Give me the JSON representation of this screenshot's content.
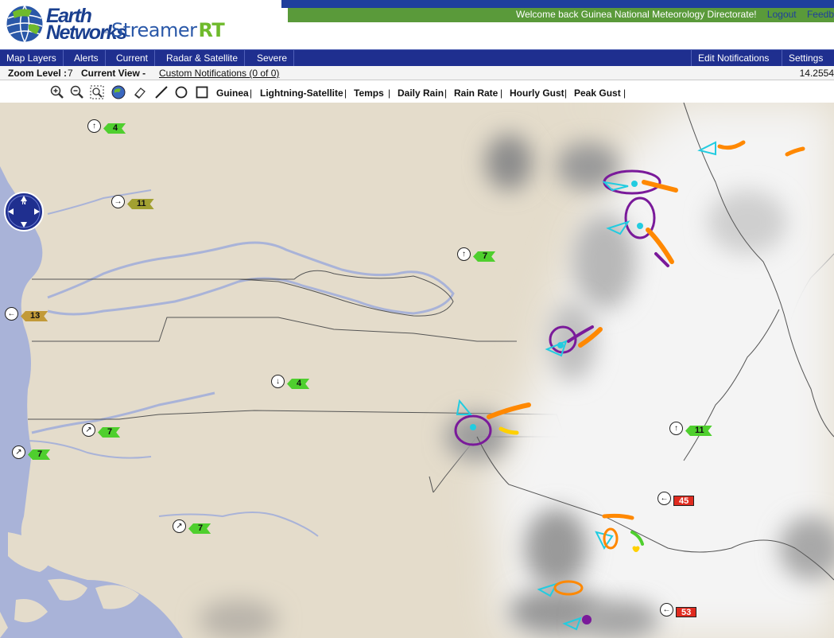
{
  "header": {
    "logo_line1": "Earth",
    "logo_line2": "Networks",
    "logo_tm": "SM",
    "product_name": "Streamer",
    "product_suffix": "RT",
    "welcome_text": "Welcome back Guinea National Meteorology Directorate!",
    "logout_label": "Logout",
    "feedback_label": "Feedb"
  },
  "menu": {
    "left": [
      "Map Layers",
      "Alerts",
      "Current",
      "Radar & Satellite",
      "Severe"
    ],
    "right": [
      "Edit Notifications",
      "Settings"
    ]
  },
  "infobar": {
    "zoom_label": "Zoom Level :",
    "zoom_value": "7",
    "view_label": "Current View -",
    "notifications_link": "Custom Notifications (0 of 0)",
    "coordinate": "14.2554"
  },
  "toolbar": {
    "tools": [
      "zoom-in-icon",
      "zoom-out-icon",
      "zoom-box-icon",
      "globe-icon",
      "eraser-icon",
      "line-draw-icon",
      "circle-draw-icon",
      "rectangle-draw-icon"
    ],
    "layers": [
      "Guinea",
      "Lightning-Satellite",
      "Temps",
      "Daily Rain",
      "Rain Rate",
      "Hourly Gust",
      "Peak Gust"
    ]
  },
  "stations": [
    {
      "value": "4",
      "arrow": "↑",
      "tag": "green"
    },
    {
      "value": "11",
      "arrow": "→",
      "tag": "olive"
    },
    {
      "value": "7",
      "arrow": "↑",
      "tag": "green"
    },
    {
      "value": "13",
      "arrow": "←",
      "tag": "gold"
    },
    {
      "value": "4",
      "arrow": "↓",
      "tag": "green"
    },
    {
      "value": "7",
      "arrow": "↗",
      "tag": "green"
    },
    {
      "value": "7",
      "arrow": "↗",
      "tag": "green"
    },
    {
      "value": "7",
      "arrow": "↗",
      "tag": "green"
    },
    {
      "value": "11",
      "arrow": "↑",
      "tag": "green"
    },
    {
      "value": "45",
      "arrow": "←",
      "tag": "red"
    },
    {
      "value": "53",
      "arrow": "←",
      "tag": "red"
    }
  ],
  "colors": {
    "menu_bg": "#1f2f8f",
    "header_green": "#5a9a3a",
    "land": "#e4dccb",
    "ocean": "#a9b3d8",
    "lightning_purple": "#7a1a9a",
    "lightning_orange": "#ff8800",
    "storm_cell_cyan": "#22cce0"
  }
}
